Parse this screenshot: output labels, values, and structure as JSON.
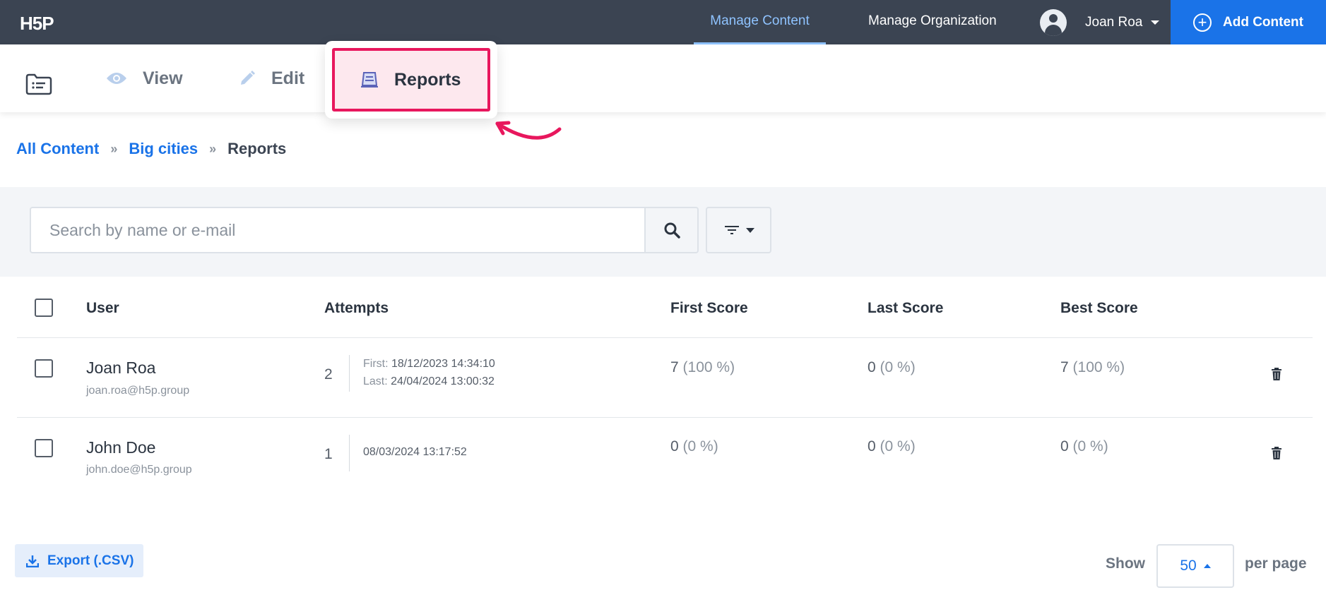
{
  "topbar": {
    "logo": "H5P",
    "nav": [
      {
        "label": "Manage Content",
        "active": true
      },
      {
        "label": "Manage Organization",
        "active": false
      }
    ],
    "user_name": "Joan Roa",
    "add_content_label": "Add Content"
  },
  "tabs": [
    {
      "label": "View",
      "icon": "eye-icon"
    },
    {
      "label": "Edit",
      "icon": "pencil-icon"
    },
    {
      "label": "Reports",
      "icon": "report-icon",
      "active": true
    }
  ],
  "breadcrumb": {
    "items": [
      "All Content",
      "Big cities"
    ],
    "separator": "»",
    "current": "Reports"
  },
  "search": {
    "placeholder": "Search by name or e-mail",
    "value": ""
  },
  "table": {
    "headers": [
      "User",
      "Attempts",
      "First Score",
      "Last Score",
      "Best Score"
    ],
    "rows": [
      {
        "name": "Joan Roa",
        "email": "joan.roa@h5p.group",
        "attempts": "2",
        "first_label": "First:",
        "first_date": "18/12/2023 14:34:10",
        "last_label": "Last:",
        "last_date": "24/04/2024 13:00:32",
        "first_score": "7",
        "first_pct": "(100 %)",
        "last_score": "0",
        "last_pct": "(0 %)",
        "best_score": "7",
        "best_pct": "(100 %)"
      },
      {
        "name": "John Doe",
        "email": "john.doe@h5p.group",
        "attempts": "1",
        "date": "08/03/2024 13:17:52",
        "first_score": "0",
        "first_pct": "(0 %)",
        "last_score": "0",
        "last_pct": "(0 %)",
        "best_score": "0",
        "best_pct": "(0 %)"
      }
    ]
  },
  "footer": {
    "export_label": "Export (.CSV)",
    "show_label": "Show",
    "per_page_value": "50",
    "per_page_label": "per page"
  },
  "colors": {
    "topbar": "#3b4452",
    "accent": "#1a73e8",
    "highlight": "#e8175d"
  }
}
